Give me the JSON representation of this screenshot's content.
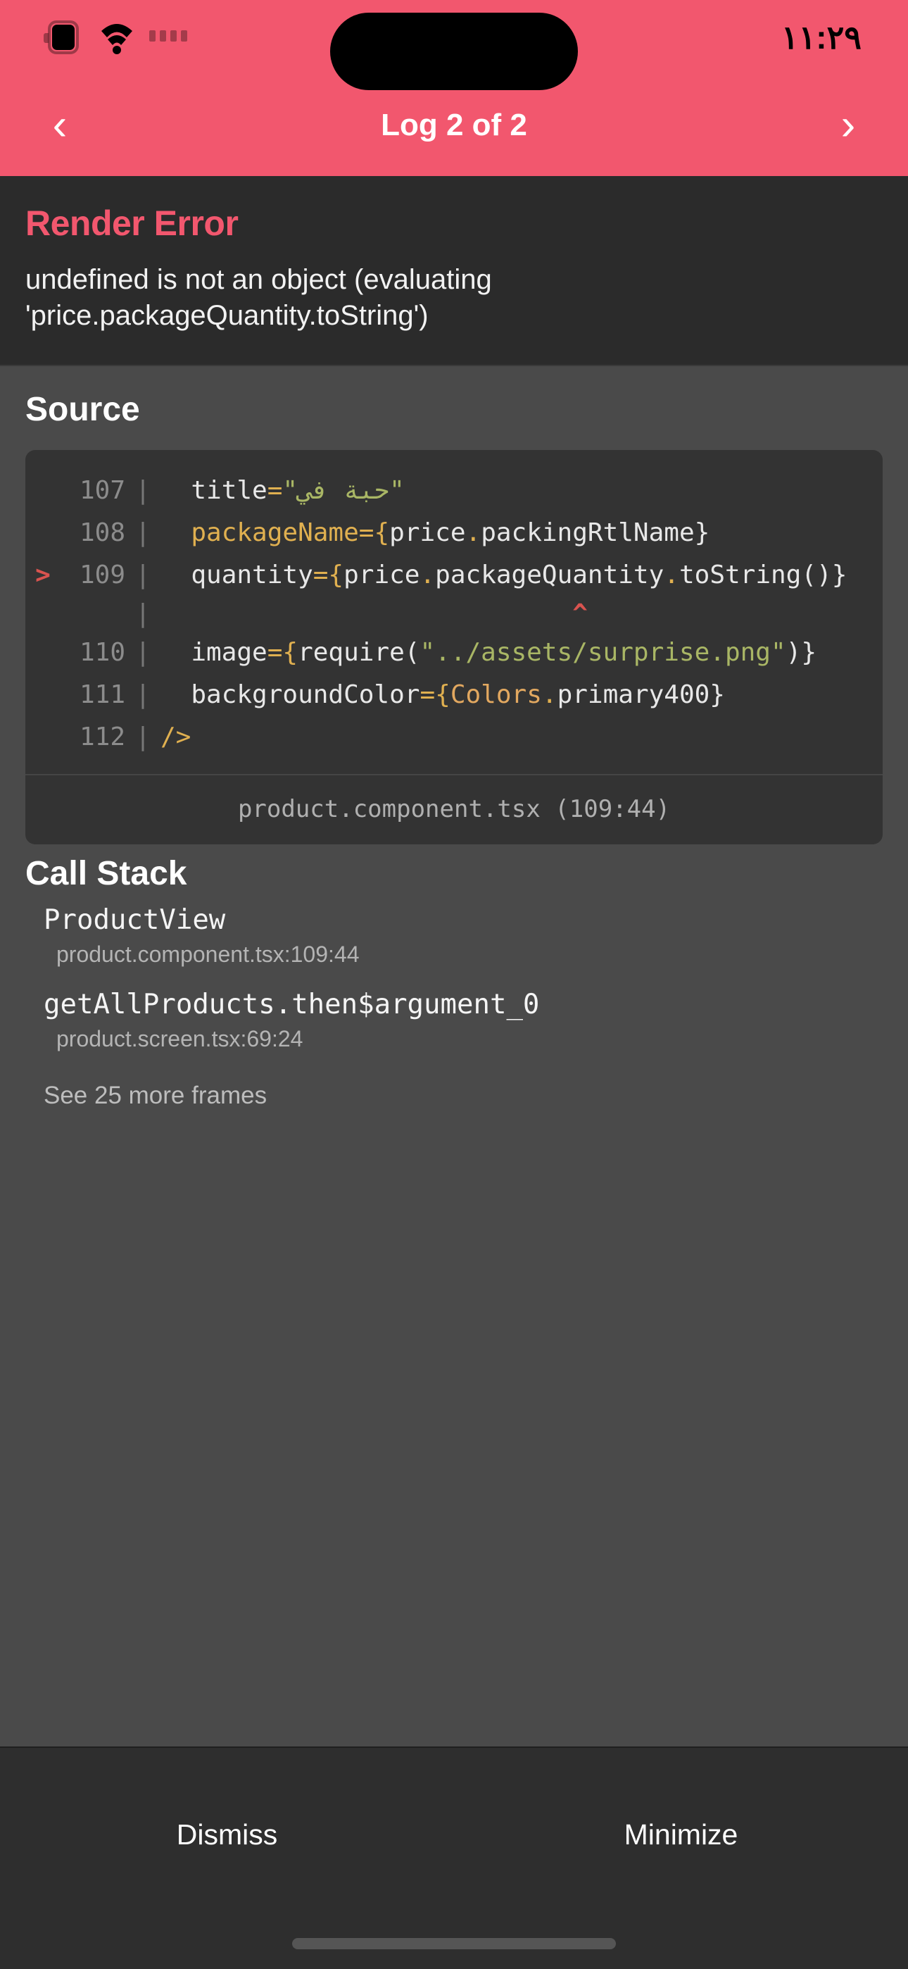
{
  "statusbar": {
    "time": "١١:٢٩",
    "battery_icon": "battery-icon",
    "wifi_icon": "wifi-icon",
    "signal_icon": "signal-dots-icon"
  },
  "header": {
    "title": "Log 2 of 2",
    "prev_arrow": "‹",
    "next_arrow": "›",
    "background_color": "#f2576e"
  },
  "error": {
    "title": "Render Error",
    "title_color": "#f2576e",
    "message": "undefined is not an object (evaluating 'price.packageQuantity.toString')"
  },
  "source": {
    "heading": "Source",
    "file": "product.component.tsx (109:44)",
    "lines": [
      {
        "number": "107",
        "marker": "",
        "pipe": "|",
        "segments": [
          {
            "text": "  title",
            "kind": "plain"
          },
          {
            "text": "=",
            "kind": "op"
          },
          {
            "text": "\"حبة في\"",
            "kind": "str"
          }
        ]
      },
      {
        "number": "108",
        "marker": "",
        "pipe": "|",
        "segments": [
          {
            "text": "  packageName",
            "kind": "op"
          },
          {
            "text": "={",
            "kind": "op"
          },
          {
            "text": "price",
            "kind": "plain"
          },
          {
            "text": ".",
            "kind": "dot"
          },
          {
            "text": "packingRtlName}",
            "kind": "plain"
          }
        ]
      },
      {
        "number": "109",
        "marker": ">",
        "pipe": "|",
        "segments": [
          {
            "text": "  quantity",
            "kind": "plain"
          },
          {
            "text": "={",
            "kind": "op"
          },
          {
            "text": "price",
            "kind": "plain"
          },
          {
            "text": ".",
            "kind": "dot"
          },
          {
            "text": "packageQuantity",
            "kind": "plain"
          },
          {
            "text": ".",
            "kind": "dot"
          },
          {
            "text": "toString()}",
            "kind": "plain"
          }
        ]
      },
      {
        "number": "",
        "marker": "",
        "pipe": "|",
        "caret": "                           ^"
      },
      {
        "number": "110",
        "marker": "",
        "pipe": "|",
        "segments": [
          {
            "text": "  image",
            "kind": "plain"
          },
          {
            "text": "={",
            "kind": "op"
          },
          {
            "text": "require(",
            "kind": "plain"
          },
          {
            "text": "\"../assets/surprise.png\"",
            "kind": "str"
          },
          {
            "text": ")}",
            "kind": "plain"
          }
        ]
      },
      {
        "number": "111",
        "marker": "",
        "pipe": "|",
        "segments": [
          {
            "text": "  backgroundColor",
            "kind": "plain"
          },
          {
            "text": "={",
            "kind": "op"
          },
          {
            "text": "Colors",
            "kind": "cls"
          },
          {
            "text": ".",
            "kind": "dot"
          },
          {
            "text": "primary400}",
            "kind": "plain"
          }
        ]
      },
      {
        "number": "112",
        "marker": "",
        "pipe": "|",
        "segments": [
          {
            "text": "/>",
            "kind": "op"
          }
        ]
      }
    ]
  },
  "callstack": {
    "heading": "Call Stack",
    "frames": [
      {
        "name": "ProductView",
        "location": "product.component.tsx:109:44"
      },
      {
        "name": "getAllProducts.then$argument_0",
        "location": "product.screen.tsx:69:24"
      }
    ],
    "more_label": "See 25 more frames"
  },
  "bottombar": {
    "dismiss_label": "Dismiss",
    "minimize_label": "Minimize"
  }
}
